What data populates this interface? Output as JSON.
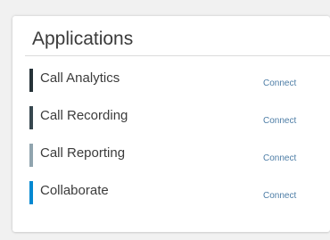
{
  "panel": {
    "title": "Applications"
  },
  "applications": [
    {
      "name": "Call Analytics",
      "action": "Connect",
      "accent_color": "#263238"
    },
    {
      "name": "Call Recording",
      "action": "Connect",
      "accent_color": "#37474f"
    },
    {
      "name": "Call Reporting",
      "action": "Connect",
      "accent_color": "#90a4ae"
    },
    {
      "name": "Collaborate",
      "action": "Connect",
      "accent_color": "#0288d1"
    }
  ]
}
